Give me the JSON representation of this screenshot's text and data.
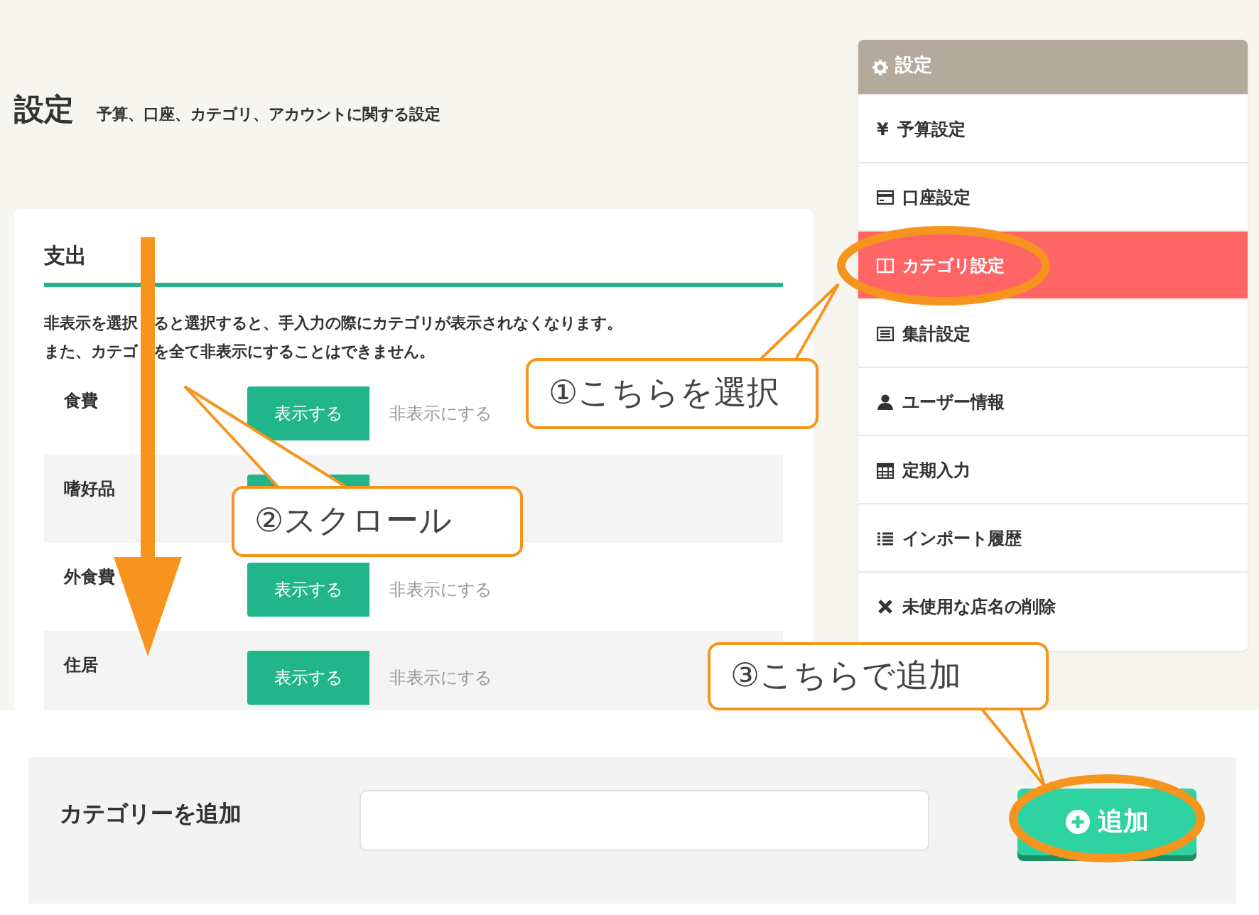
{
  "page": {
    "title": "設定",
    "subtitle": "予算、口座、カテゴリ、アカウントに関する設定"
  },
  "section": {
    "title": "支出",
    "notes": [
      {
        "parts": [
          "非表示を選択",
          "ると選択すると、手入力の際にカテゴリが表示されなくなります。"
        ]
      },
      {
        "parts": [
          "また、カテゴ",
          "を全て非表示にすることはできません。"
        ]
      }
    ],
    "rows": [
      {
        "name": "食費",
        "show_label": "表示する",
        "hide_label": "非表示にする",
        "visible": true
      },
      {
        "name": "嗜好品",
        "visible": true
      },
      {
        "name": "外食費",
        "show_label": "表示する",
        "hide_label": "非表示にする",
        "visible": true
      },
      {
        "name": "住居",
        "show_label": "表示する",
        "hide_label": "非表示にする",
        "visible": true
      }
    ]
  },
  "sidebar": {
    "title": "設定",
    "items": [
      {
        "label": "予算設定",
        "glyph": "¥",
        "selected": false
      },
      {
        "label": "口座設定",
        "kind": "card",
        "selected": false
      },
      {
        "label": "カテゴリ設定",
        "kind": "columns",
        "selected": true
      },
      {
        "label": "集計設定",
        "kind": "panel",
        "selected": false
      },
      {
        "label": "ユーザー情報",
        "kind": "user",
        "selected": false
      },
      {
        "label": "定期入力",
        "kind": "calendar",
        "selected": false
      },
      {
        "label": "インポート履歴",
        "kind": "list",
        "selected": false
      },
      {
        "label": "未使用な店名の削除",
        "kind": "cross",
        "selected": false
      }
    ]
  },
  "add_form": {
    "label": "カテゴリーを追加",
    "button": "追加"
  },
  "annotations": [
    {
      "text": "①こちらを選択"
    },
    {
      "text": "②スクロール"
    },
    {
      "text": "③こちらで追加"
    }
  ]
}
